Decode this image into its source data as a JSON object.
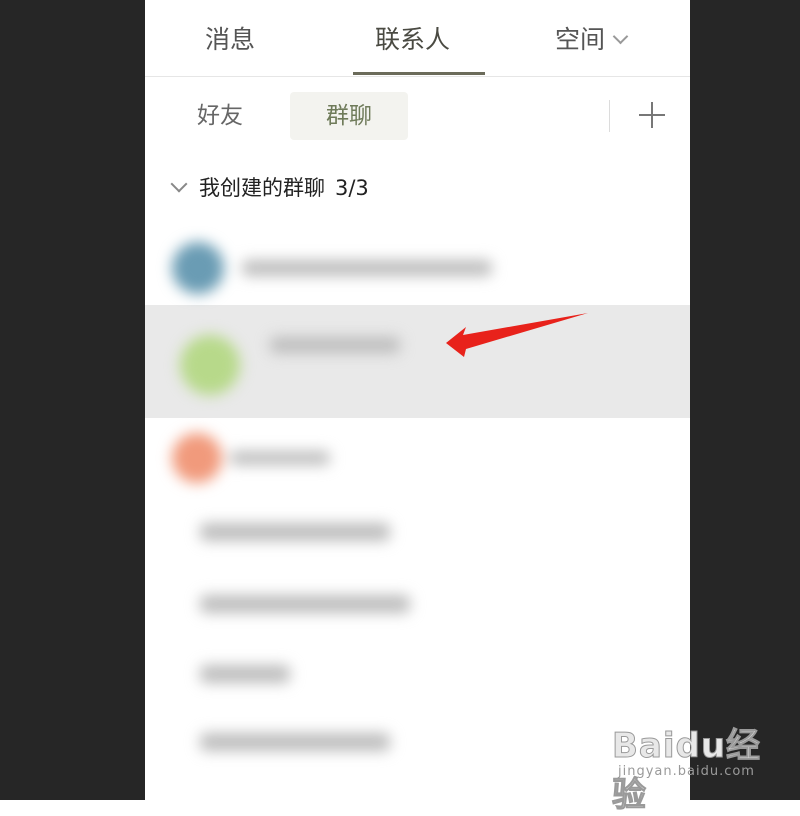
{
  "tabs": {
    "messages": "消息",
    "contacts": "联系人",
    "space": "空间"
  },
  "subtabs": {
    "friends": "好友",
    "groups": "群聊"
  },
  "section": {
    "title": "我创建的群聊",
    "count": "3/3"
  },
  "watermark": {
    "logo": "Baidu经验",
    "url": "jingyan.baidu.com"
  },
  "colors": {
    "active_tab_underline": "#6b6b5a",
    "annotation_arrow": "#e8221b"
  },
  "icons": {
    "space_dropdown": "chevron-down-icon",
    "add": "plus-icon",
    "collapse": "chevron-down-icon"
  }
}
